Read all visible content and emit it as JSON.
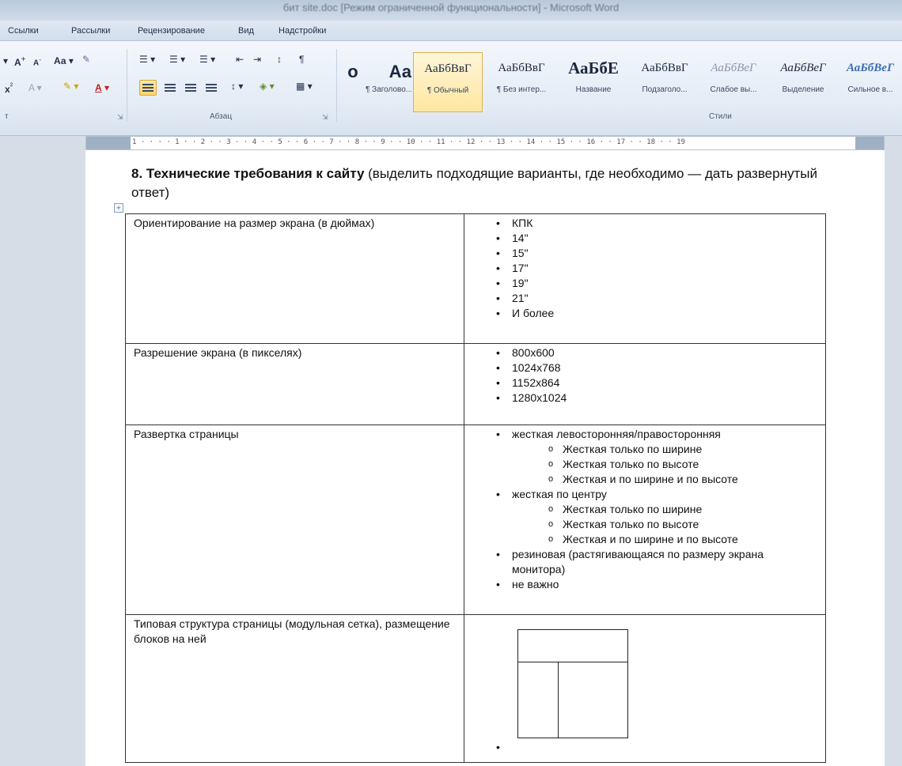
{
  "window": {
    "title": "бит site.doc [Режим ограниченной функциональности] - Microsoft Word"
  },
  "ribbon": {
    "tabs": [
      "Ссылки",
      "Рассылки",
      "Рецензирование",
      "Вид",
      "Надстройки"
    ],
    "groups": {
      "font_short": "т",
      "paragraph": "Абзац",
      "styles": "Стили"
    },
    "font_controls": {
      "grow": "A",
      "shrink": "A",
      "case": "Аа",
      "superscript": "x",
      "color_a": "A"
    },
    "styles": [
      {
        "sample": "о",
        "name": ""
      },
      {
        "sample": "Аа",
        "name": "¶ Заголово..."
      },
      {
        "sample": "АаБбВвГ",
        "name": "¶ Обычный"
      },
      {
        "sample": "АаБбВвГ",
        "name": "¶ Без интер..."
      },
      {
        "sample": "АаБбЕ",
        "name": "Название"
      },
      {
        "sample": "АаБбВвГ",
        "name": "Подзаголо..."
      },
      {
        "sample": "АаБбВеГ",
        "name": "Слабое вы..."
      },
      {
        "sample": "АаБбВеГ",
        "name": "Выделение"
      },
      {
        "sample": "АаБбВеГ",
        "name": "Сильное в..."
      }
    ]
  },
  "ruler": {
    "marks": "1 · · · · 1 · · 2 · · 3 · · 4 · · 5 · · 6 · · 7 · · 8 · · 9 · · 10 · · 11 · · 12 · · 13 · · 14 · · 15 · · 16 · · 17 · · 18 · · 19"
  },
  "document": {
    "heading_bold": "8. Технические требования к сайту",
    "heading_rest": " (выделить подходящие варианты, где необходимо — дать развернутый ответ)",
    "table_handle": "+",
    "rows": [
      {
        "label": "Ориентирование на размер экрана (в дюймах)",
        "options": [
          "КПК",
          "14\"",
          "15\"",
          "17\"",
          "19\"",
          "21\"",
          "И более"
        ]
      },
      {
        "label": "Разрешение экрана (в пикселях)",
        "options": [
          "800x600",
          "1024x768",
          "1152x864",
          "1280x1024"
        ]
      },
      {
        "label": "Развертка страницы",
        "options": [
          "жесткая левосторонняя/правосторонняя",
          "Жесткая только по ширине",
          "Жесткая только по высоте",
          "Жесткая и по ширине и по высоте",
          "жесткая по центру",
          "Жесткая только по ширине",
          "Жесткая только по высоте",
          "Жесткая и по ширине и по высоте",
          "резиновая (растягивающаяся по размеру экрана монитора)",
          "не важно"
        ]
      },
      {
        "label": "Типовая структура страницы (модульная сетка), размещение блоков на ней",
        "options": []
      }
    ]
  }
}
